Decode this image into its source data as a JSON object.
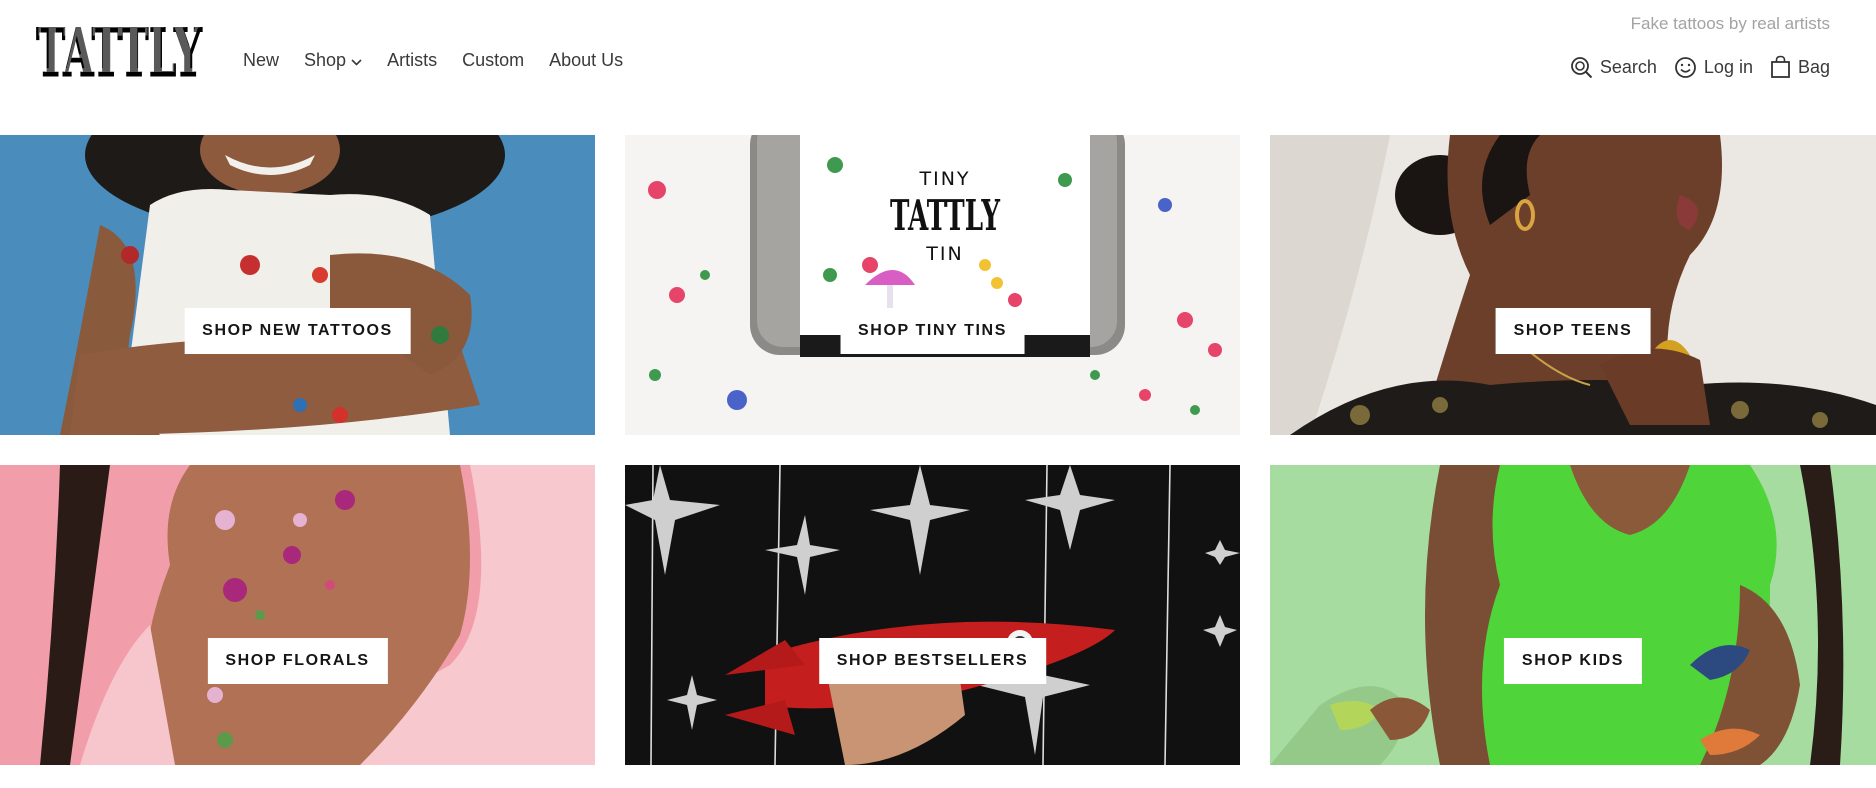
{
  "brand": {
    "logo_text": "TATTLY",
    "tagline": "Fake tattoos by real artists"
  },
  "nav": {
    "items": [
      {
        "label": "New"
      },
      {
        "label": "Shop"
      },
      {
        "label": "Artists"
      },
      {
        "label": "Custom"
      },
      {
        "label": "About Us"
      }
    ]
  },
  "utility": {
    "search": "Search",
    "login": "Log in",
    "bag": "Bag"
  },
  "tiles": [
    {
      "label": "SHOP NEW TATTOOS",
      "image": "arms-with-snoopy-tattoos"
    },
    {
      "label": "SHOP TINY TINS",
      "image": "tiny-tattly-tin-flowers",
      "tin_text": [
        "TINY",
        "TATTLY",
        "TIN"
      ]
    },
    {
      "label": "SHOP TEENS",
      "image": "teen-moth-tattoo-shoulder"
    },
    {
      "label": "SHOP FLORALS",
      "image": "shoulder-floral-tattoos"
    },
    {
      "label": "SHOP BESTSELLERS",
      "image": "rocket-and-stars"
    },
    {
      "label": "SHOP KIDS",
      "image": "kid-dinosaur-tattoos"
    }
  ],
  "colors": {
    "text": "#3a3a3a",
    "tagline": "#a3a3a3",
    "tile_new": "#4a8dbd",
    "tile_tins": "#f0eeec",
    "tile_teens": "#e7e3de",
    "tile_florals": "#f2a0ab",
    "tile_bestsellers": "#121212",
    "tile_kids": "#a7dca0"
  }
}
